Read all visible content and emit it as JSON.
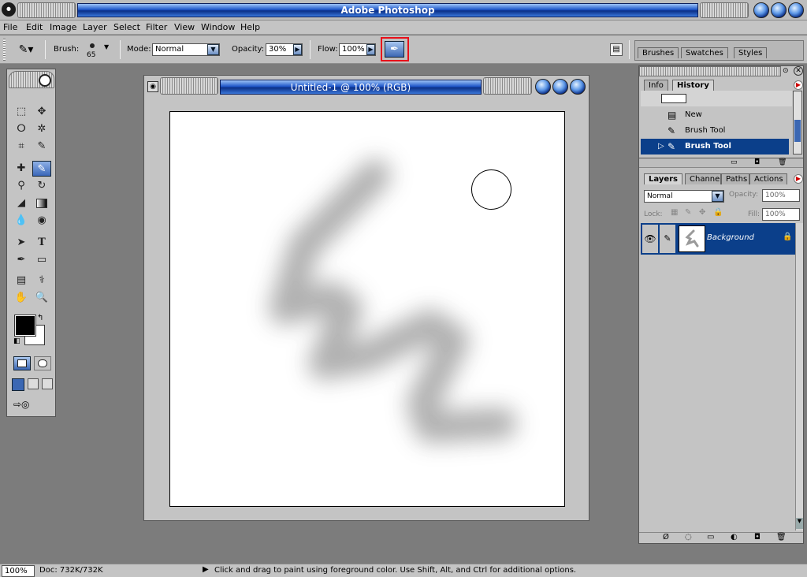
{
  "app": {
    "title": "Adobe Photoshop"
  },
  "menu": [
    "File",
    "Edit",
    "Image",
    "Layer",
    "Select",
    "Filter",
    "View",
    "Window",
    "Help"
  ],
  "options": {
    "brush_label": "Brush:",
    "brush_size": "65",
    "mode_label": "Mode:",
    "mode_value": "Normal",
    "opacity_label": "Opacity:",
    "opacity_value": "30%",
    "flow_label": "Flow:",
    "flow_value": "100%",
    "well_tabs": [
      "Brushes",
      "Swatches",
      "Styles"
    ]
  },
  "document": {
    "title": "Untitled-1 @ 100% (RGB)"
  },
  "history": {
    "tabs": [
      "Info",
      "History"
    ],
    "items": [
      "New",
      "Brush Tool",
      "Brush Tool"
    ]
  },
  "layers": {
    "tabs": [
      "Layers",
      "Channels",
      "Paths",
      "Actions"
    ],
    "blend_mode": "Normal",
    "opacity_label": "Opacity:",
    "opacity_value": "100%",
    "lock_label": "Lock:",
    "fill_label": "Fill:",
    "fill_value": "100%",
    "layer_name": "Background"
  },
  "status": {
    "zoom": "100%",
    "doc": "Doc: 732K/732K",
    "hint": "Click and drag to paint using foreground color.  Use Shift, Alt, and Ctrl for additional options."
  },
  "colors": {
    "highlight_box": "#e8101a",
    "selection": "#0b3f8a",
    "foreground": "#000000",
    "background": "#ffffff"
  },
  "icons": [
    "photoshop-logo-icon",
    "brush-icon",
    "palette-menu-icon",
    "eye-icon",
    "lock-icon",
    "marquee-icon",
    "lasso-icon",
    "crop-icon",
    "healing-icon",
    "stamp-icon",
    "eraser-icon",
    "gradient-icon",
    "blur-icon",
    "dodge-icon",
    "path-select-icon",
    "type-icon",
    "pen-icon",
    "shape-icon",
    "notes-icon",
    "eyedropper-icon",
    "hand-icon",
    "zoom-icon"
  ]
}
